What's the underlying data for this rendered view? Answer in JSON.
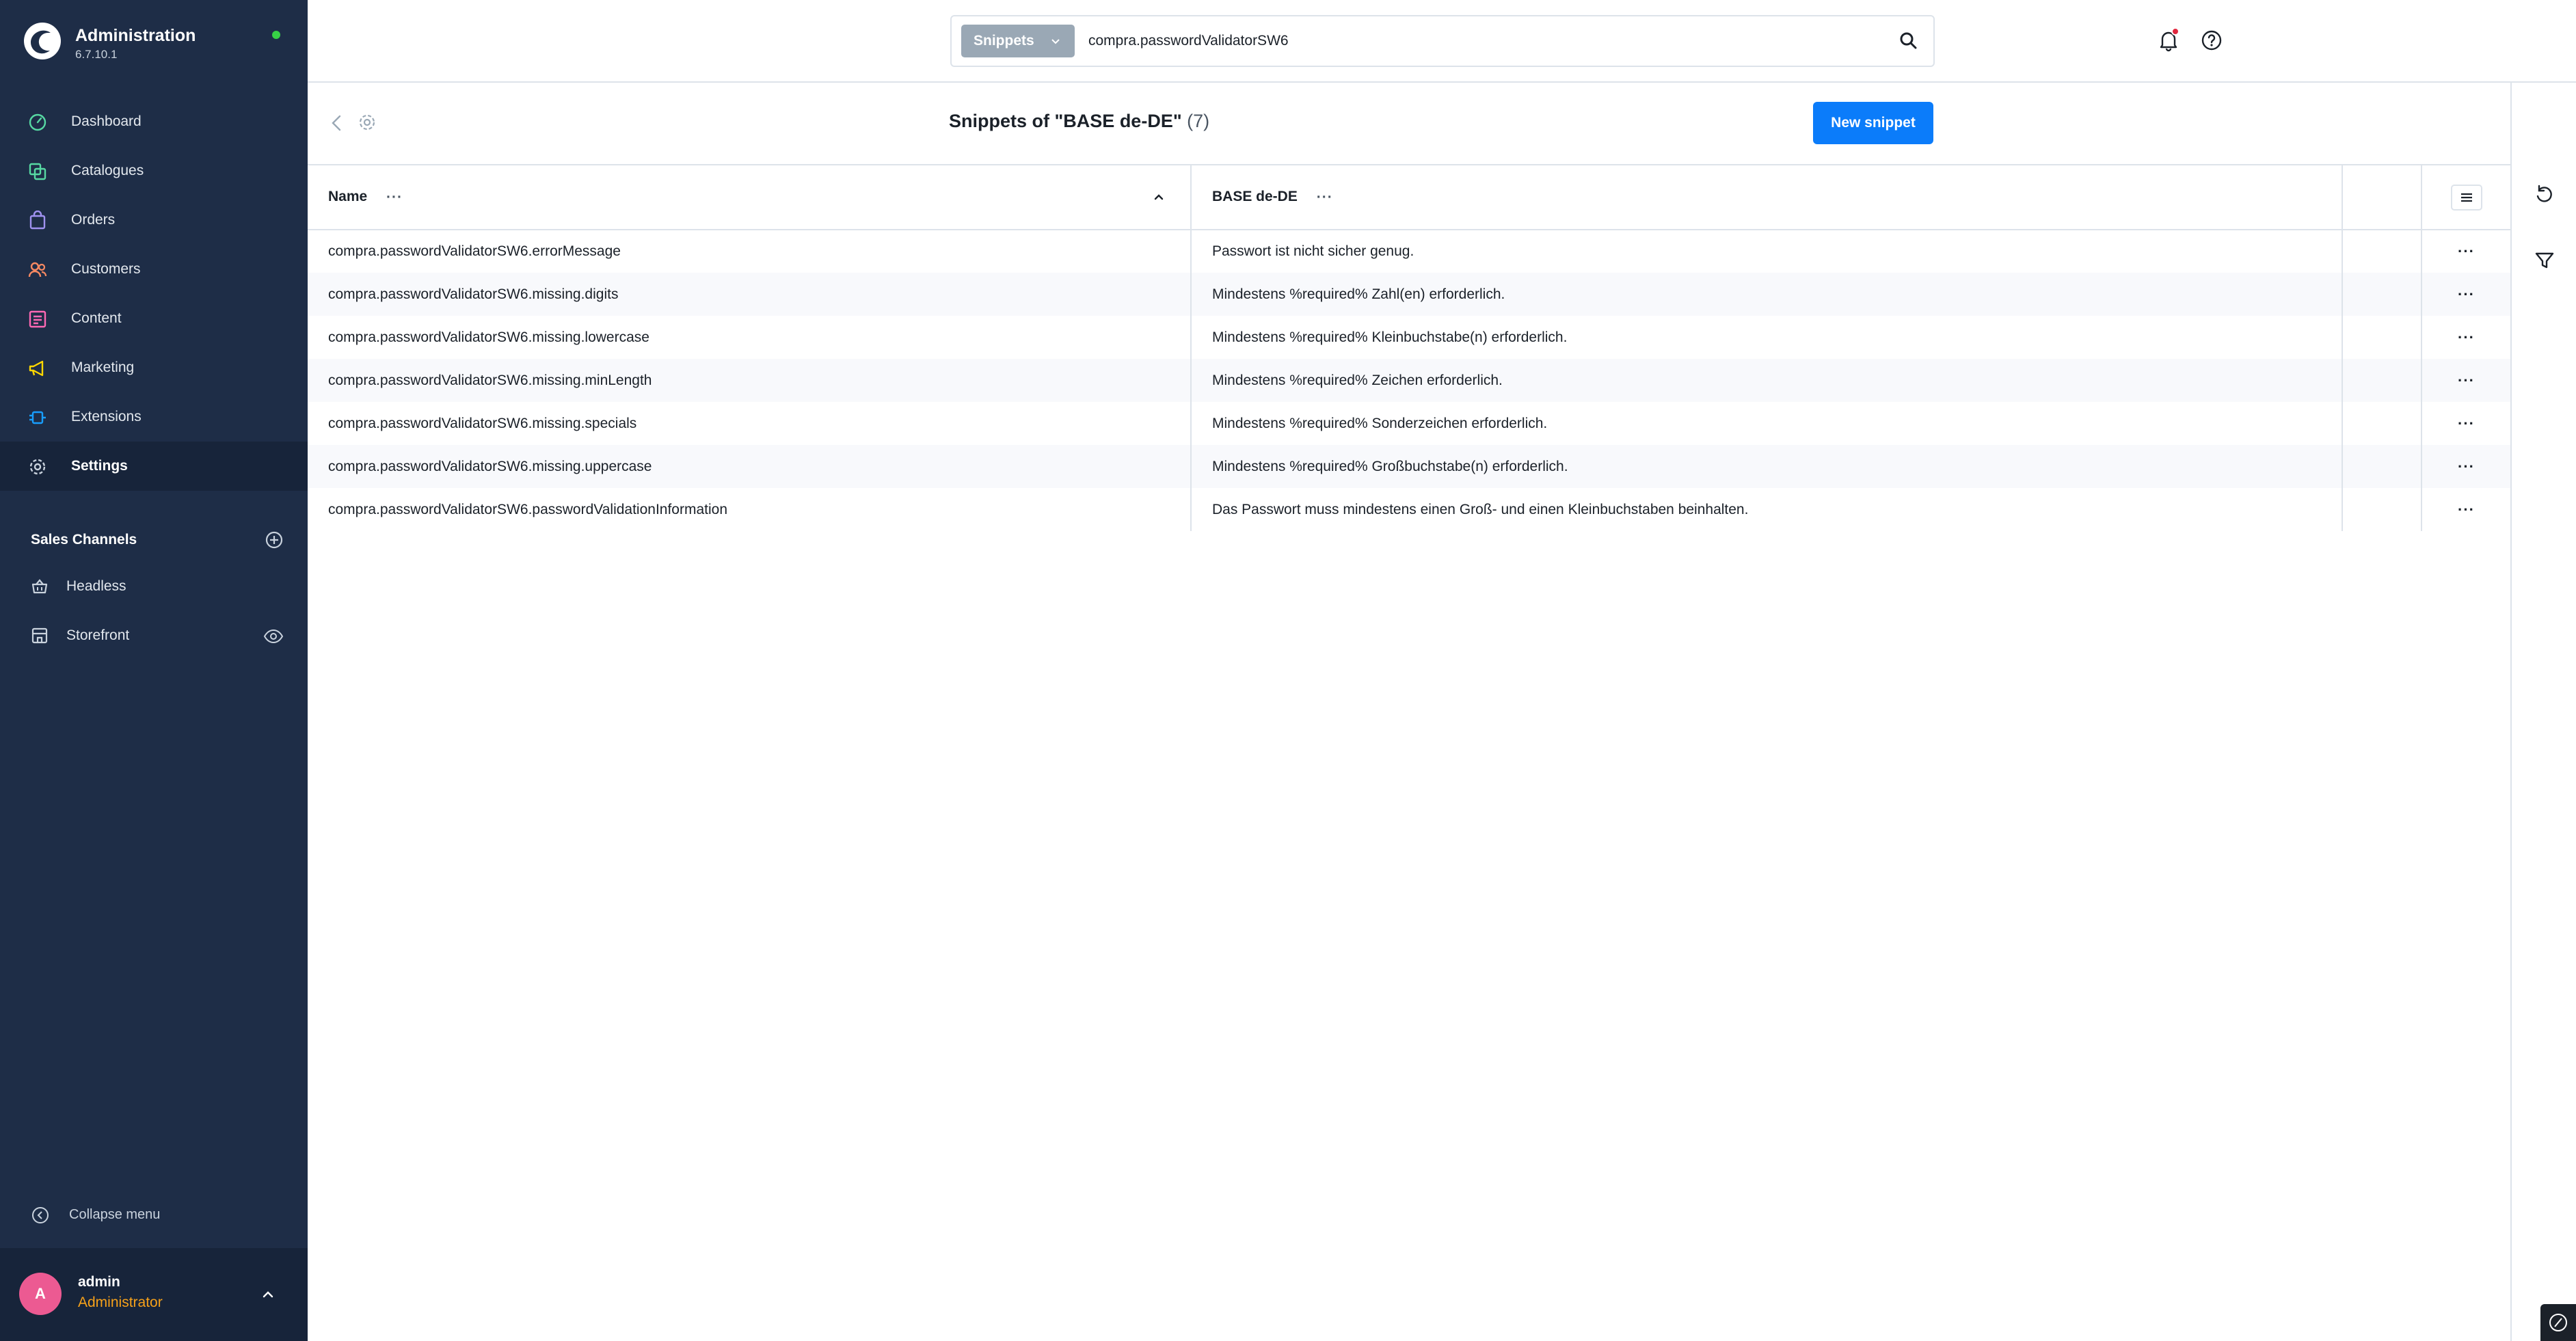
{
  "app": {
    "title": "Administration",
    "version": "6.7.10.1",
    "status_color": "#37d046"
  },
  "nav": {
    "items": [
      {
        "label": "Dashboard",
        "icon": "dashboard-icon",
        "color": "#57d9a3"
      },
      {
        "label": "Catalogues",
        "icon": "catalogues-icon",
        "color": "#57d9a3"
      },
      {
        "label": "Orders",
        "icon": "orders-icon",
        "color": "#a092f0"
      },
      {
        "label": "Customers",
        "icon": "customers-icon",
        "color": "#f88962"
      },
      {
        "label": "Content",
        "icon": "content-icon",
        "color": "#ff68b4"
      },
      {
        "label": "Marketing",
        "icon": "marketing-icon",
        "color": "#ffd700"
      },
      {
        "label": "Extensions",
        "icon": "extensions-icon",
        "color": "#189eff"
      },
      {
        "label": "Settings",
        "icon": "settings-icon",
        "color": "#9aa8b5",
        "active": true
      }
    ]
  },
  "sales_channels": {
    "title": "Sales Channels",
    "items": [
      {
        "label": "Headless",
        "icon": "basket-icon"
      },
      {
        "label": "Storefront",
        "icon": "storefront-icon"
      }
    ]
  },
  "sidebar_footer": {
    "collapse_label": "Collapse menu",
    "user_initial": "A",
    "user_name": "admin",
    "user_role": "Administrator"
  },
  "search": {
    "type_label": "Snippets",
    "value": "compra.passwordValidatorSW6"
  },
  "header": {
    "title": "Snippets of \"BASE de-DE\"",
    "count": "(7)",
    "new_button": "New snippet"
  },
  "table": {
    "columns": {
      "name": "Name",
      "value": "BASE de-DE",
      "more": "···"
    },
    "rows": [
      {
        "name": "compra.passwordValidatorSW6.errorMessage",
        "value": "Passwort ist nicht sicher genug."
      },
      {
        "name": "compra.passwordValidatorSW6.missing.digits",
        "value": "Mindestens %required% Zahl(en) erforderlich."
      },
      {
        "name": "compra.passwordValidatorSW6.missing.lowercase",
        "value": "Mindestens %required% Kleinbuchstabe(n) erforderlich."
      },
      {
        "name": "compra.passwordValidatorSW6.missing.minLength",
        "value": "Mindestens %required% Zeichen erforderlich."
      },
      {
        "name": "compra.passwordValidatorSW6.missing.specials",
        "value": "Mindestens %required% Sonderzeichen erforderlich."
      },
      {
        "name": "compra.passwordValidatorSW6.missing.uppercase",
        "value": "Mindestens %required% Großbuchstabe(n) erforderlich."
      },
      {
        "name": "compra.passwordValidatorSW6.passwordValidationInformation",
        "value": "Das Passwort muss mindestens einen Groß- und einen Kleinbuchstaben beinhalten."
      }
    ]
  },
  "colors": {
    "sidebar_bg": "#1e2d47",
    "sidebar_active_bg": "#17243a",
    "primary": "#0b7cfa",
    "role_text": "#f6a11a",
    "avatar_bg": "#ec5a92",
    "notification_dot": "#e1273e"
  }
}
